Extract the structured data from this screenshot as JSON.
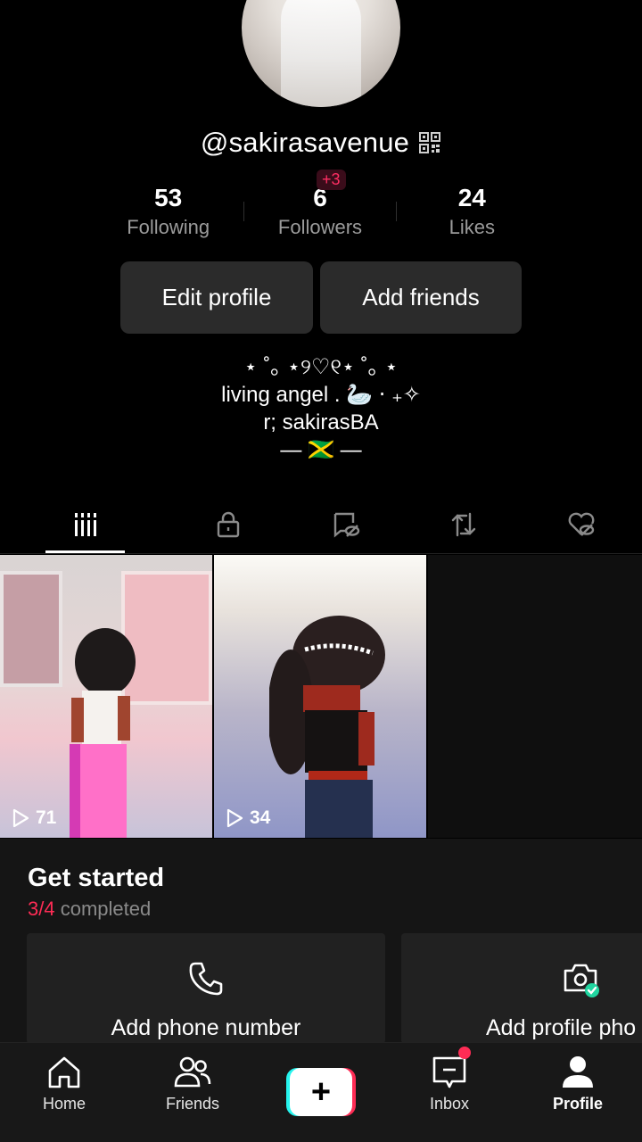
{
  "profile": {
    "username": "@sakirasavenue",
    "stats": {
      "following": {
        "value": "53",
        "label": "Following"
      },
      "followers": {
        "value": "6",
        "label": "Followers",
        "new_badge": "+3"
      },
      "likes": {
        "value": "24",
        "label": "Likes"
      }
    },
    "buttons": {
      "edit": "Edit profile",
      "add_friends": "Add friends"
    },
    "bio": [
      "⋆ ˚｡ ⋆୨♡୧⋆ ˚｡ ⋆",
      "living angel . 🦢 ⋅ ₊✧",
      "r; sakirasBA",
      "— 🇯🇲 —"
    ]
  },
  "tabs": [
    {
      "name": "videos-grid",
      "icon": "grid-bars-icon",
      "active": true
    },
    {
      "name": "private",
      "icon": "lock-icon",
      "active": false
    },
    {
      "name": "hidden",
      "icon": "hidden-video-icon",
      "active": false
    },
    {
      "name": "reposts",
      "icon": "repost-icon",
      "active": false
    },
    {
      "name": "liked",
      "icon": "liked-hidden-icon",
      "active": false
    }
  ],
  "videos": [
    {
      "views": "71"
    },
    {
      "views": "34"
    }
  ],
  "get_started": {
    "title": "Get started",
    "progress": "3/4",
    "progress_suffix": "completed",
    "cards": [
      {
        "label": "Add phone number",
        "icon": "phone-icon"
      },
      {
        "label": "Add profile pho",
        "icon": "camera-check-icon"
      }
    ]
  },
  "navbar": {
    "items": [
      {
        "label": "Home",
        "icon": "home-icon"
      },
      {
        "label": "Friends",
        "icon": "friends-icon"
      },
      {
        "label": "",
        "icon": "plus-icon"
      },
      {
        "label": "Inbox",
        "icon": "inbox-icon"
      },
      {
        "label": "Profile",
        "icon": "profile-icon"
      }
    ]
  },
  "colors": {
    "background": "#000000",
    "accent_red": "#fe2c55",
    "accent_cyan": "#25f4ee",
    "button_bg": "#2b2b2b",
    "muted_text": "#9b9b9b"
  }
}
